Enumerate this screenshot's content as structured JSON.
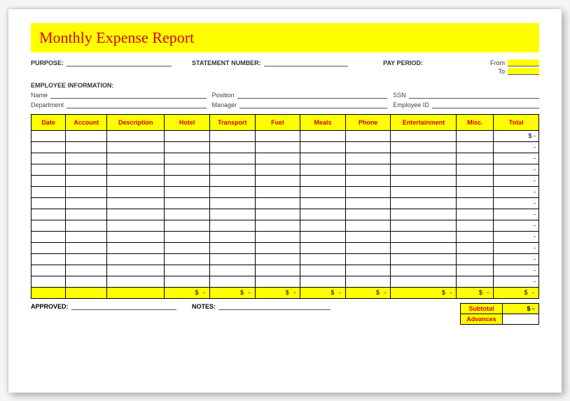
{
  "title": "Monthly Expense Report",
  "meta": {
    "purpose_label": "PURPOSE:",
    "statement_label": "STATEMENT NUMBER:",
    "pay_period_label": "PAY PERIOD:",
    "from_label": "From",
    "to_label": "To"
  },
  "emp": {
    "section": "EMPLOYEE INFORMATION:",
    "name": "Name",
    "position": "Position",
    "ssn": "SSN",
    "department": "Department",
    "manager": "Manager",
    "employee_id": "Employee ID"
  },
  "columns": {
    "date": "Date",
    "account": "Account",
    "description": "Description",
    "hotel": "Hotel",
    "transport": "Transport",
    "fuel": "Fuel",
    "meals": "Meals",
    "phone": "Phone",
    "entertainment": "Entertainment",
    "misc": "Misc.",
    "total": "Total"
  },
  "row_total_first": "$       -",
  "row_total_dash": "-",
  "col_total": "$    -",
  "footer": {
    "approved": "APPROVED:",
    "notes": "NOTES:",
    "subtotal": "Subtotal",
    "subtotal_val": "$       -",
    "advances": "Advances"
  }
}
